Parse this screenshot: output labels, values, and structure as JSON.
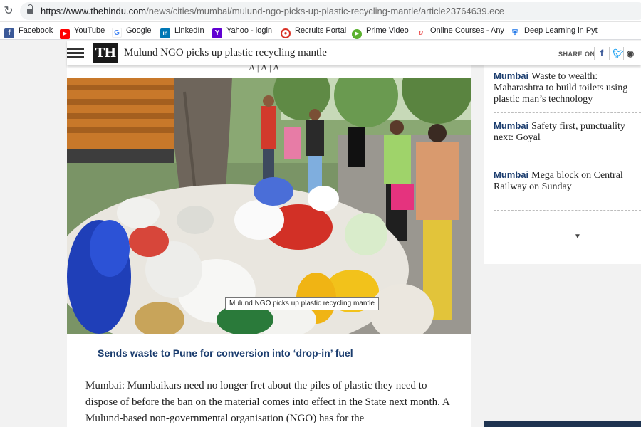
{
  "browser": {
    "url_host": "https://www.thehindu.com",
    "url_path": "/news/cities/mumbai/mulund-ngo-picks-up-plastic-recycling-mantle/article23764639.ece",
    "bookmarks": [
      {
        "label": "Facebook",
        "icon": "facebook-icon",
        "color": "#3b5998"
      },
      {
        "label": "YouTube",
        "icon": "youtube-icon",
        "color": "#ff0000"
      },
      {
        "label": "Google",
        "icon": "google-icon",
        "color": "#4285f4"
      },
      {
        "label": "LinkedIn",
        "icon": "linkedin-icon",
        "color": "#0077b5"
      },
      {
        "label": "Yahoo - login",
        "icon": "yahoo-icon",
        "color": "#6001d2"
      },
      {
        "label": "Recruits Portal",
        "icon": "recruits-icon",
        "color": "#d93025"
      },
      {
        "label": "Prime Video",
        "icon": "prime-video-icon",
        "color": "#5bb12f"
      },
      {
        "label": "Online Courses - Any",
        "icon": "udemy-icon",
        "color": "#ec5252"
      },
      {
        "label": "Deep Learning in Pyt",
        "icon": "shield-icon",
        "color": "#1a73e8"
      }
    ]
  },
  "header": {
    "logo": "TH",
    "title": "Mulund NGO picks up plastic recycling mantle",
    "share_label": "SHARE ON",
    "share_icons": [
      "facebook-share-icon",
      "twitter-share-icon",
      "reddit-share-icon"
    ]
  },
  "font_controls": "A | A | A",
  "article": {
    "image_tooltip": "Mulund NGO picks up plastic recycling mantle",
    "subtitle": "Sends waste to Pune for conversion into ‘drop-in’ fuel",
    "body": "Mumbai: Mumbaikars need no longer fret about the piles of plastic they need to dispose of before the ban on the material comes into effect in the State next month. A Mulund-based non-governmental organisation (NGO) has for the"
  },
  "sidebar": {
    "items": [
      {
        "city": "Mumbai",
        "headline": "Waste to wealth: Maharashtra to build toilets using plastic man’s technology"
      },
      {
        "city": "Mumbai",
        "headline": "Safety first, punctuality next: Goyal"
      },
      {
        "city": "Mumbai",
        "headline": "Mega block on Central Railway on Sunday"
      }
    ],
    "more_arrow": "▼"
  },
  "colors": {
    "accent": "#1a3c6e",
    "strip": "#1e3350"
  }
}
